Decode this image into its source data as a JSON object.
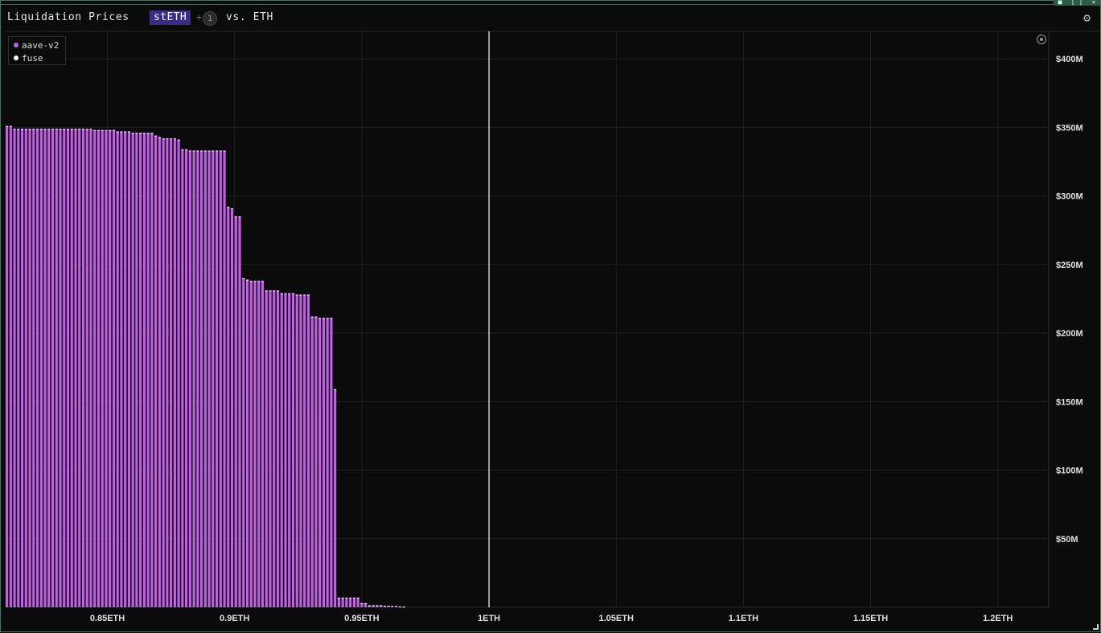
{
  "header": {
    "title": "Liquidation Prices",
    "symbol": "stETH",
    "plus": "+",
    "extra_count": "1",
    "vs_label": "vs. ETH"
  },
  "icons": {
    "settings": "gear-icon",
    "reset_zoom": "target-icon",
    "resize": "resize-handle-icon"
  },
  "chart_data": {
    "type": "bar",
    "title": "",
    "xlabel": "",
    "ylabel": "",
    "xlim": [
      0.81,
      1.22
    ],
    "ylim": [
      0,
      420
    ],
    "y_unit": "M USD",
    "grid": true,
    "legend_position": "top-left",
    "bar_width_eth": 0.001,
    "reference_line": {
      "x": 1.0,
      "color": "#ffffff"
    },
    "x_ticks": [
      {
        "value": 0.85,
        "label": "0.85ETH"
      },
      {
        "value": 0.9,
        "label": "0.9ETH"
      },
      {
        "value": 0.95,
        "label": "0.95ETH"
      },
      {
        "value": 1.0,
        "label": "1ETH"
      },
      {
        "value": 1.05,
        "label": "1.05ETH"
      },
      {
        "value": 1.1,
        "label": "1.1ETH"
      },
      {
        "value": 1.15,
        "label": "1.15ETH"
      },
      {
        "value": 1.2,
        "label": "1.2ETH"
      }
    ],
    "y_ticks": [
      {
        "value": 50,
        "label": "$50M"
      },
      {
        "value": 100,
        "label": "$100M"
      },
      {
        "value": 150,
        "label": "$150M"
      },
      {
        "value": 200,
        "label": "$200M"
      },
      {
        "value": 250,
        "label": "$250M"
      },
      {
        "value": 300,
        "label": "$300M"
      },
      {
        "value": 350,
        "label": "$350M"
      },
      {
        "value": 400,
        "label": "$400M"
      }
    ],
    "series": [
      {
        "name": "aave-v2",
        "color": "#c35ee8",
        "x": [
          0.8105,
          0.812,
          0.8135,
          0.815,
          0.8165,
          0.818,
          0.8195,
          0.821,
          0.8225,
          0.824,
          0.8255,
          0.827,
          0.8285,
          0.83,
          0.8315,
          0.833,
          0.8345,
          0.836,
          0.8375,
          0.839,
          0.8405,
          0.842,
          0.8435,
          0.845,
          0.8465,
          0.848,
          0.8495,
          0.851,
          0.8525,
          0.854,
          0.8555,
          0.857,
          0.8585,
          0.86,
          0.8615,
          0.863,
          0.8645,
          0.866,
          0.8675,
          0.869,
          0.8705,
          0.872,
          0.8735,
          0.875,
          0.8765,
          0.878,
          0.8795,
          0.881,
          0.8825,
          0.884,
          0.8855,
          0.887,
          0.8885,
          0.89,
          0.8915,
          0.893,
          0.8945,
          0.896,
          0.8975,
          0.899,
          0.9005,
          0.902,
          0.9035,
          0.905,
          0.9065,
          0.908,
          0.9095,
          0.911,
          0.9125,
          0.914,
          0.9155,
          0.917,
          0.9185,
          0.92,
          0.9215,
          0.923,
          0.9245,
          0.926,
          0.9275,
          0.929,
          0.9305,
          0.932,
          0.9335,
          0.935,
          0.9365,
          0.938,
          0.9395,
          0.941,
          0.9425,
          0.944,
          0.9455,
          0.947,
          0.9485,
          0.95,
          0.9515,
          0.953,
          0.9545,
          0.956,
          0.9575,
          0.959,
          0.9605,
          0.962,
          0.9635,
          0.965,
          0.9665
        ],
        "values": [
          351,
          351,
          349,
          349,
          349,
          349,
          349,
          349,
          349,
          349,
          349,
          349,
          349,
          349,
          349,
          349,
          349,
          349,
          349,
          349,
          349,
          349,
          349,
          348,
          348,
          348,
          348,
          348,
          348,
          347,
          347,
          347,
          347,
          346,
          346,
          346,
          346,
          346,
          346,
          344,
          343,
          342,
          342,
          342,
          342,
          341,
          334,
          334,
          333,
          333,
          333,
          333,
          333,
          333,
          333,
          333,
          333,
          333,
          292,
          291,
          285,
          285,
          240,
          239,
          238,
          238,
          238,
          238,
          231,
          231,
          231,
          231,
          229,
          229,
          229,
          229,
          228,
          228,
          228,
          228,
          212,
          212,
          211,
          211,
          211,
          211,
          159,
          7,
          7,
          7,
          7,
          7,
          7,
          3,
          3,
          1.5,
          1.5,
          1.5,
          1.5,
          1,
          1,
          0.8,
          0.8,
          0.5,
          0.5
        ]
      },
      {
        "name": "fuse",
        "color": "#ffffff",
        "x": [],
        "values": []
      }
    ]
  }
}
